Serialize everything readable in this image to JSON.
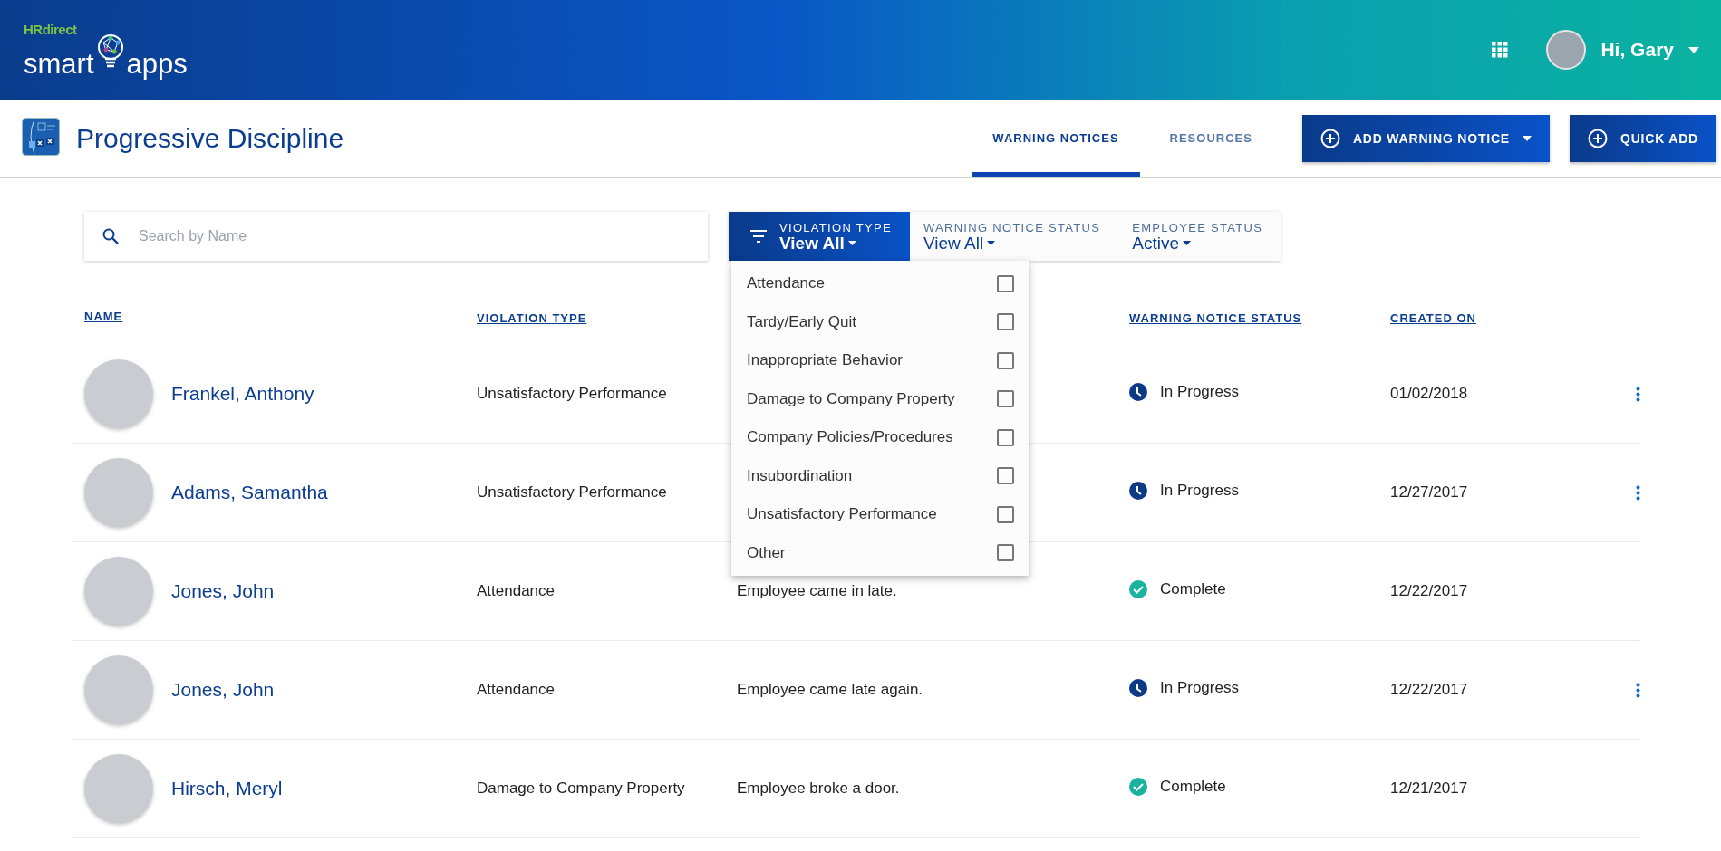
{
  "header": {
    "brand_top": "HRdirect",
    "brand_left": "smart",
    "brand_right": "apps",
    "greeting": "Hi, Gary"
  },
  "app": {
    "title": "Progressive Discipline"
  },
  "tabs": [
    {
      "label": "WARNING NOTICES",
      "selected": true
    },
    {
      "label": "RESOURCES",
      "selected": false
    }
  ],
  "actions": [
    {
      "label": "ADD WARNING NOTICE",
      "dropdown": true
    },
    {
      "label": "QUICK ADD",
      "dropdown": false
    }
  ],
  "search": {
    "placeholder": "Search by Name"
  },
  "filters": [
    {
      "label": "VIOLATION TYPE",
      "value": "View All",
      "selected": true
    },
    {
      "label": "WARNING NOTICE STATUS",
      "value": "View All",
      "selected": false
    },
    {
      "label": "EMPLOYEE STATUS",
      "value": "Active",
      "selected": false
    }
  ],
  "violation_menu": [
    {
      "label": "Attendance",
      "checked": false
    },
    {
      "label": "Tardy/Early Quit",
      "checked": false
    },
    {
      "label": "Inappropriate Behavior",
      "checked": false
    },
    {
      "label": "Damage to Company Property",
      "checked": false
    },
    {
      "label": "Company Policies/Procedures",
      "checked": false
    },
    {
      "label": "Insubordination",
      "checked": false
    },
    {
      "label": "Unsatisfactory Performance",
      "checked": false
    },
    {
      "label": "Other",
      "checked": false
    }
  ],
  "table": {
    "columns": [
      "NAME",
      "VIOLATION TYPE",
      "WARNING NOTICE STATUS",
      "CREATED ON"
    ],
    "rows": [
      {
        "name": "Frankel, Anthony",
        "violation": "Unsatisfactory Performance",
        "status": "In Progress",
        "kind": "in_progress",
        "created": "01/02/2018",
        "menu": true
      },
      {
        "name": "Adams, Samantha",
        "violation": "Unsatisfactory Performance",
        "status": "In Progress",
        "kind": "in_progress",
        "created": "12/27/2017",
        "menu": true
      },
      {
        "name": "Jones, John",
        "violation": "Attendance",
        "description": "Employee came in late.",
        "status": "Complete",
        "kind": "complete",
        "created": "12/22/2017",
        "menu": false
      },
      {
        "name": "Jones, John",
        "violation": "Attendance",
        "description": "Employee came late again.",
        "status": "In Progress",
        "kind": "in_progress",
        "created": "12/22/2017",
        "menu": true
      },
      {
        "name": "Hirsch, Meryl",
        "violation": "Damage to Company Property",
        "description": "Employee broke a door.",
        "status": "Complete",
        "kind": "complete",
        "created": "12/21/2017",
        "menu": false
      }
    ]
  }
}
